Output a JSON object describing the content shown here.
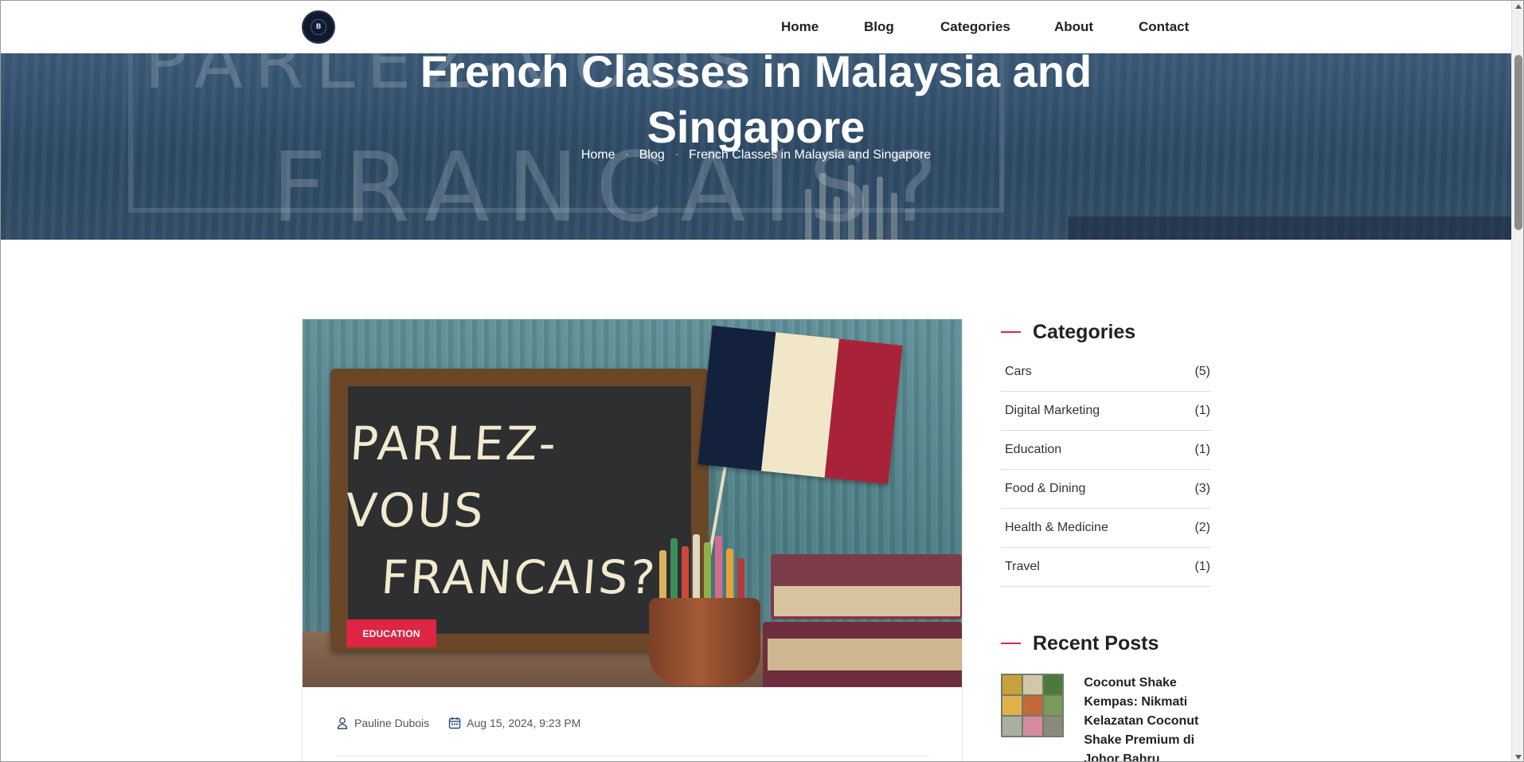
{
  "nav": {
    "logo_alt": "B",
    "items": [
      {
        "label": "Home"
      },
      {
        "label": "Blog"
      },
      {
        "label": "Categories"
      },
      {
        "label": "About"
      },
      {
        "label": "Contact"
      }
    ]
  },
  "hero": {
    "title_line1": "French Classes in Malaysia and",
    "title_line2": "Singapore",
    "breadcrumb": {
      "home": "Home",
      "blog": "Blog",
      "current": "French Classes in Malaysia and Singapore",
      "separator": "-"
    },
    "chalk_text_1": "PARLEZ-VOUS",
    "chalk_text_2": "FRANCAIS?"
  },
  "post": {
    "image_text_line1": "PARLEZ-VOUS",
    "image_text_line2": "FRANCAIS?",
    "category_badge": "EDUCATION",
    "author": "Pauline Dubois",
    "date": "Aug 15, 2024, 9:23 PM",
    "author_icon": "user-icon",
    "date_icon": "calendar-icon"
  },
  "sidebar": {
    "categories_title": "Categories",
    "categories": [
      {
        "name": "Cars",
        "count": "(5)"
      },
      {
        "name": "Digital Marketing",
        "count": "(1)"
      },
      {
        "name": "Education",
        "count": "(1)"
      },
      {
        "name": "Food & Dining",
        "count": "(3)"
      },
      {
        "name": "Health & Medicine",
        "count": "(2)"
      },
      {
        "name": "Travel",
        "count": "(1)"
      }
    ],
    "recent_title": "Recent Posts",
    "recent_posts": [
      {
        "title": "Coconut Shake Kempas: Nikmati Kelazatan Coconut Shake Premium di Johor Bahru"
      }
    ]
  },
  "colors": {
    "accent": "#dc2643",
    "hero_overlay": "#2f4f6c",
    "text": "#222222"
  }
}
